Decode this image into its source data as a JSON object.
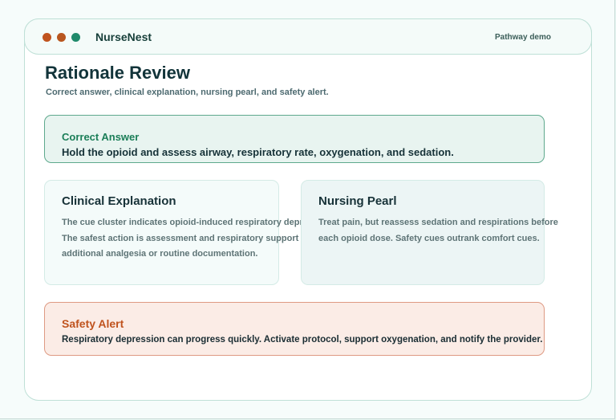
{
  "app": {
    "name": "NurseNest",
    "badge": "Pathway demo"
  },
  "page": {
    "title": "Rationale Review",
    "subtitle": "Correct answer, clinical explanation, nursing pearl, and safety alert."
  },
  "correct_answer": {
    "heading": "Correct Answer",
    "text": "Hold the opioid and assess airway, respiratory rate, oxygenation, and sedation."
  },
  "clinical_explanation": {
    "heading": "Clinical Explanation",
    "line1": "The cue cluster indicates opioid-induced respiratory depression.",
    "line2": "The safest action is assessment and respiratory support before",
    "line3": "additional analgesia or routine documentation."
  },
  "nursing_pearl": {
    "heading": "Nursing Pearl",
    "line1": "Treat pain, but reassess sedation and respirations before",
    "line2": "each opioid dose. Safety cues outrank comfort cues."
  },
  "safety_alert": {
    "heading": "Safety Alert",
    "text": "Respiratory depression can progress quickly. Activate protocol, support oxygenation, and notify the provider."
  },
  "colors": {
    "accent_green": "#1b7e58",
    "alert_orange": "#c0531e",
    "window_dots": [
      "#c0531e",
      "#b8561f",
      "#1f8a6b"
    ]
  }
}
